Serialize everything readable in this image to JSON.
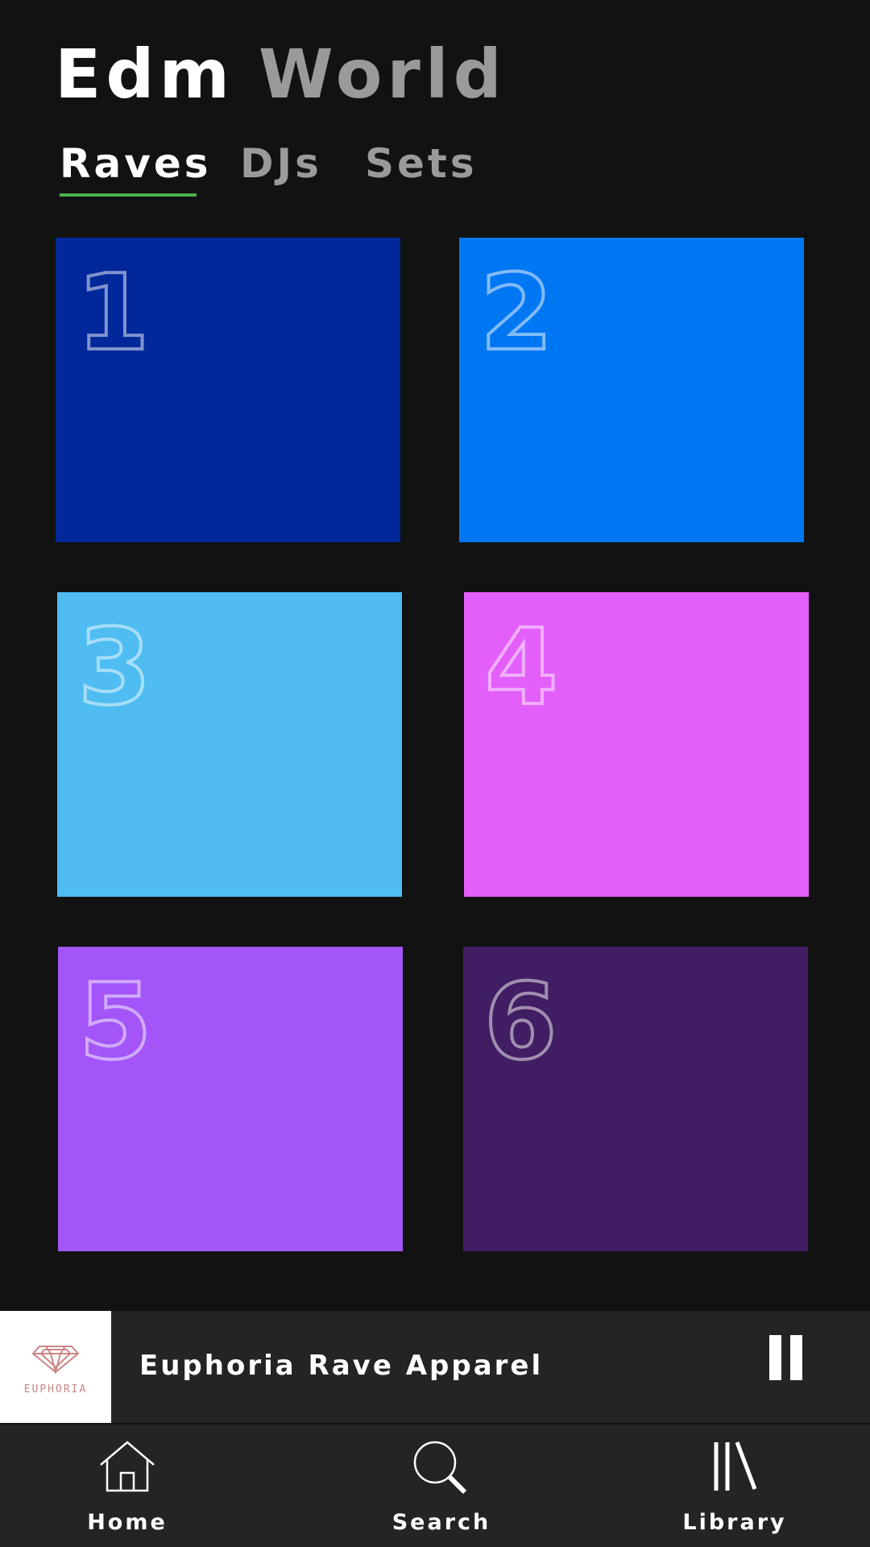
{
  "header": {
    "title_part1": "Edm",
    "title_part2": "World"
  },
  "tabs": [
    {
      "label": "Raves",
      "active": true
    },
    {
      "label": "DJs",
      "active": false
    },
    {
      "label": "Sets",
      "active": false
    }
  ],
  "accent_color": "#4caf50",
  "tiles": [
    {
      "number": "1",
      "color": "#00289a"
    },
    {
      "number": "2",
      "color": "#0077f2"
    },
    {
      "number": "3",
      "color": "#4fbdf2"
    },
    {
      "number": "4",
      "color": "#e35ffa"
    },
    {
      "number": "5",
      "color": "#a355f8"
    },
    {
      "number": "6",
      "color": "#411d63"
    }
  ],
  "now_playing": {
    "title": "Euphoria Rave Apparel",
    "artwork_logo_text": "EUPHORIA",
    "artwork_icon": "diamond-logo",
    "control_icon": "pause-icon"
  },
  "bottom_nav": [
    {
      "label": "Home",
      "icon": "home-icon"
    },
    {
      "label": "Search",
      "icon": "search-icon"
    },
    {
      "label": "Library",
      "icon": "library-icon"
    }
  ]
}
